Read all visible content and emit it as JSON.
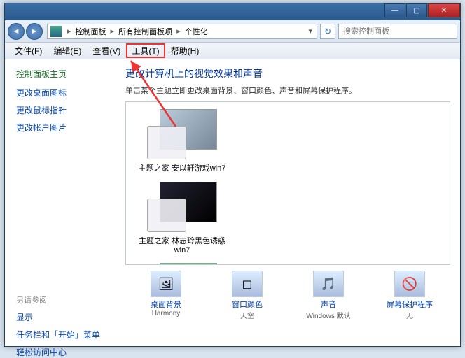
{
  "titlebar": {
    "min": "—",
    "max": "▢",
    "close": "✕"
  },
  "nav": {
    "back": "◄",
    "fwd": "►",
    "crumbs": [
      "控制面板",
      "所有控制面板项",
      "个性化"
    ],
    "sep": "▸",
    "dropdown": "▾",
    "refresh": "↻",
    "search_placeholder": "搜索控制面板"
  },
  "menu": {
    "file": "文件(F)",
    "edit": "编辑(E)",
    "view": "查看(V)",
    "tools": "工具(T)",
    "help": "帮助(H)"
  },
  "sidebar": {
    "home": "控制面板主页",
    "links": [
      "更改桌面图标",
      "更改鼠标指针",
      "更改帐户图片"
    ],
    "also_label": "另请参阅",
    "also": [
      "显示",
      "任务栏和「开始」菜单",
      "轻松访问中心"
    ]
  },
  "main": {
    "title": "更改计算机上的视觉效果和声音",
    "subtitle": "单击某个主题立即更改桌面背景、窗口颜色、声音和屏幕保护程序。",
    "themes": [
      {
        "name": "主题之家 安以轩游戏win7"
      },
      {
        "name": "主题之家 林志玲黑色诱惑win7"
      }
    ],
    "bottom": [
      {
        "label": "桌面背景",
        "value": "Harmony",
        "icon": "🖼"
      },
      {
        "label": "窗口颜色",
        "value": "天空",
        "icon": "◻"
      },
      {
        "label": "声音",
        "value": "Windows 默认",
        "icon": "🎵"
      },
      {
        "label": "屏幕保护程序",
        "value": "无",
        "icon": "🚫"
      }
    ]
  }
}
